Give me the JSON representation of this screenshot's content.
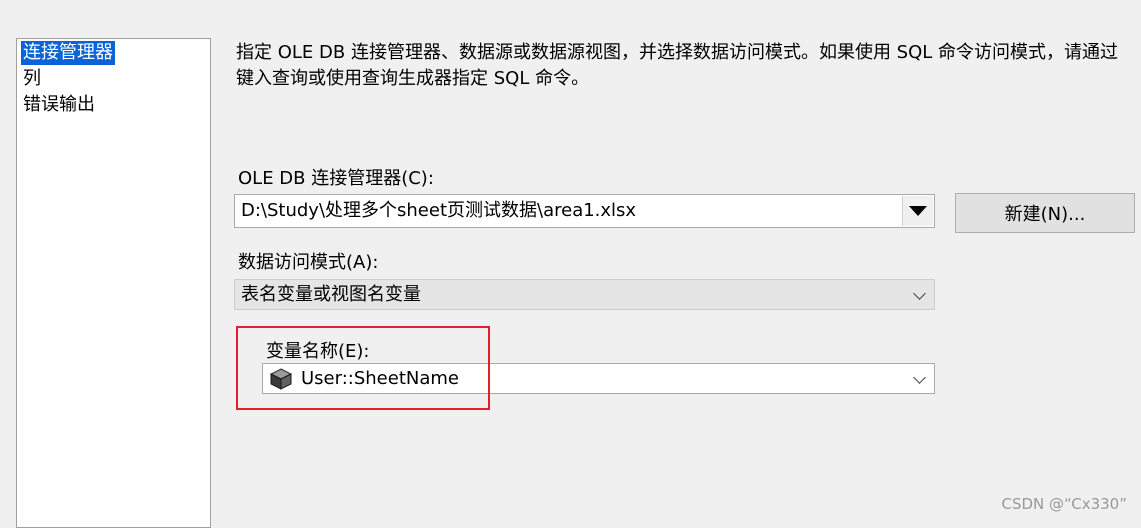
{
  "nav": {
    "items": [
      {
        "label": "连接管理器",
        "selected": true
      },
      {
        "label": "列",
        "selected": false
      },
      {
        "label": "错误输出",
        "selected": false
      }
    ]
  },
  "main": {
    "description": "指定 OLE DB 连接管理器、数据源或数据源视图，并选择数据访问模式。如果使用 SQL 命令访问模式，请通过键入查询或使用查询生成器指定 SQL 命令。",
    "connection_label": "OLE DB 连接管理器(C):",
    "connection_value": "D:\\Study\\处理多个sheet页测试数据\\area1.xlsx",
    "new_button_label": "新建(N)...",
    "access_mode_label": "数据访问模式(A):",
    "access_mode_value": "表名变量或视图名变量",
    "variable_label": "变量名称(E):",
    "variable_value": "User::SheetName",
    "variable_icon": "variable-icon"
  },
  "watermark": "CSDN @“Cx330”",
  "colors": {
    "selection": "#0a64d8",
    "highlight_border": "#e0202a"
  }
}
